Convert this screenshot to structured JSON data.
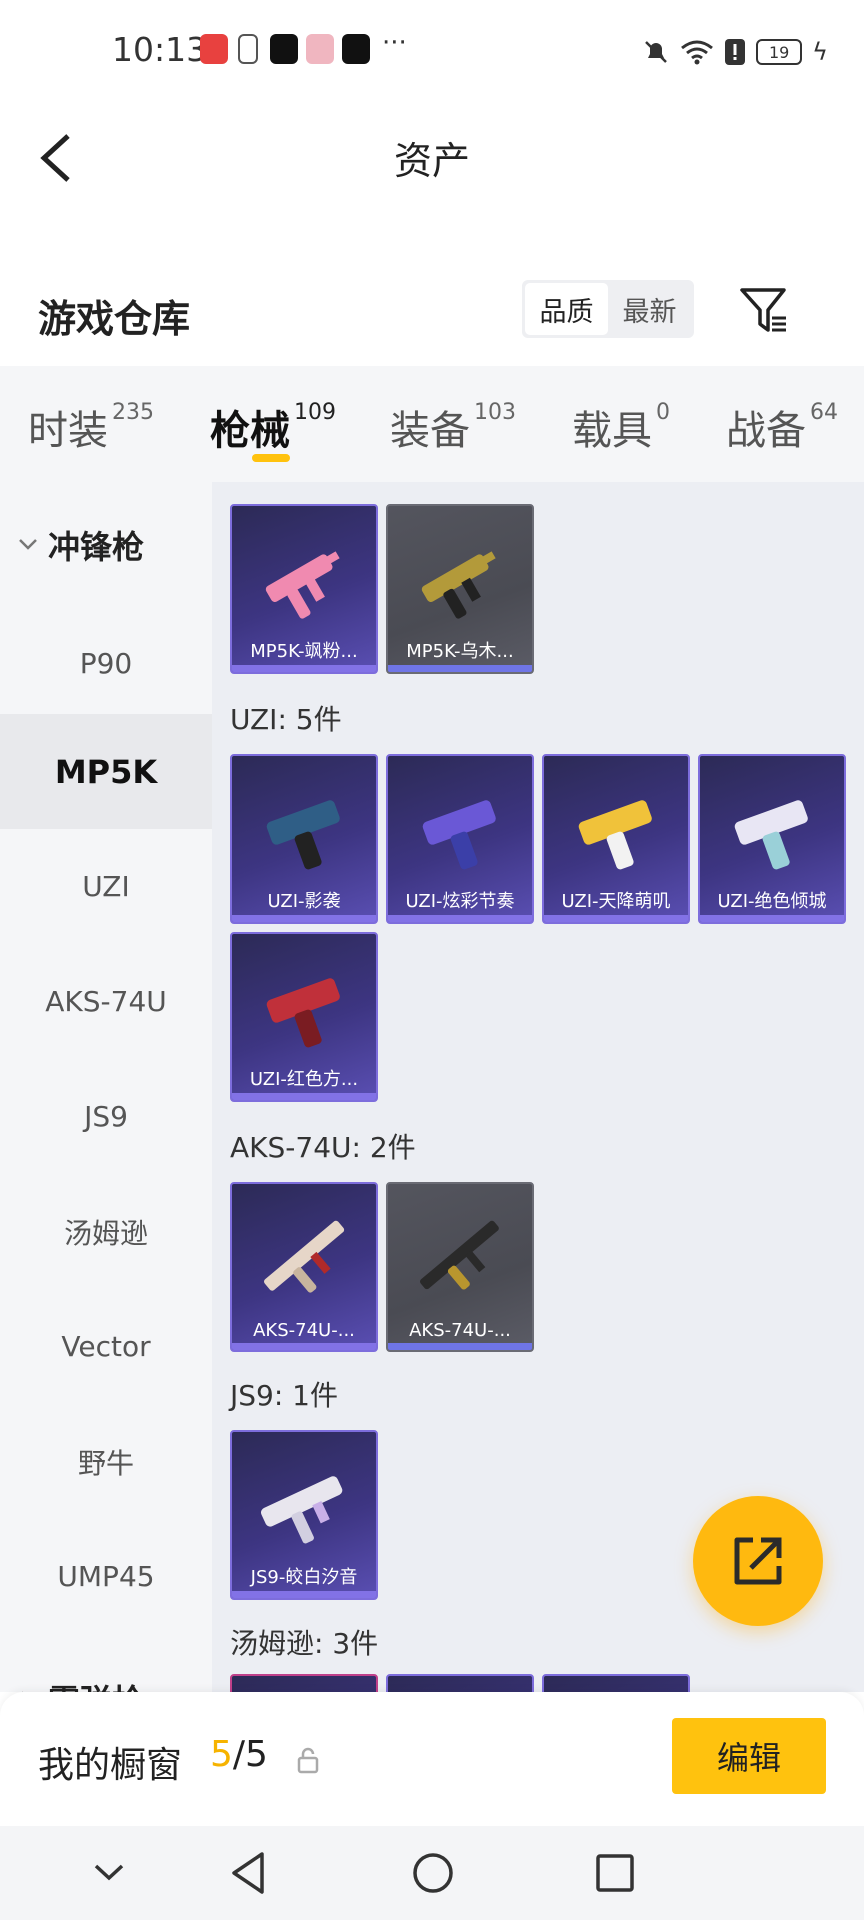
{
  "status_bar": {
    "time": "10:13",
    "more": "···",
    "battery": "19",
    "app_icon_colors": [
      "#e8413f",
      "#555555",
      "#111111",
      "#e85c73",
      "#111111"
    ]
  },
  "header": {
    "title": "资产"
  },
  "warehouse": {
    "title": "游戏仓库",
    "sort_options": [
      "品质",
      "最新"
    ],
    "active_sort": "品质"
  },
  "tabs": [
    {
      "label": "时装",
      "count": "235"
    },
    {
      "label": "枪械",
      "count": "109",
      "active": true
    },
    {
      "label": "装备",
      "count": "103"
    },
    {
      "label": "载具",
      "count": "0"
    },
    {
      "label": "战备",
      "count": "64"
    }
  ],
  "sidebar": {
    "group": "冲锋枪",
    "items": [
      "P90",
      "MP5K",
      "UZI",
      "AKS-74U",
      "JS9",
      "汤姆逊",
      "Vector",
      "野牛",
      "UMP45"
    ],
    "active_item": "MP5K",
    "next_group": "霰弹枪"
  },
  "content": {
    "mp5k_items": [
      {
        "name": "MP5K-飒粉...",
        "style": "purple",
        "gun_color": "#f08ab0"
      },
      {
        "name": "MP5K-乌木...",
        "style": "gray",
        "gun_color": "#b39a3a"
      }
    ],
    "uzi_label": "UZI: 5件",
    "uzi_items": [
      {
        "name": "UZI-影袭",
        "style": "purple",
        "gun_color": "#2f5e86"
      },
      {
        "name": "UZI-炫彩节奏",
        "style": "purple",
        "gun_color": "#6a58d6"
      },
      {
        "name": "UZI-天降萌叽",
        "style": "purple",
        "gun_color": "#f0c23a"
      },
      {
        "name": "UZI-绝色倾城",
        "style": "purple",
        "gun_color": "#e8e6f4"
      },
      {
        "name": "UZI-红色方...",
        "style": "purple",
        "gun_color": "#c0303a"
      }
    ],
    "aks_label": "AKS-74U: 2件",
    "aks_items": [
      {
        "name": "AKS-74U-...",
        "style": "purple",
        "gun_color": "#e6d6c8"
      },
      {
        "name": "AKS-74U-...",
        "style": "gray",
        "gun_color": "#2a2a2a"
      }
    ],
    "js9_label": "JS9: 1件",
    "js9_items": [
      {
        "name": "JS9-皎白汐音",
        "style": "purple",
        "gun_color": "#e8e6ee"
      }
    ],
    "thompson_label": "汤姆逊: 3件"
  },
  "showcase": {
    "title": "我的橱窗",
    "current": "5",
    "total": "/5",
    "edit_label": "编辑"
  },
  "colors": {
    "accent": "#ffc20e",
    "card_purple": "#3d3582",
    "card_gray": "#4a4b53"
  }
}
